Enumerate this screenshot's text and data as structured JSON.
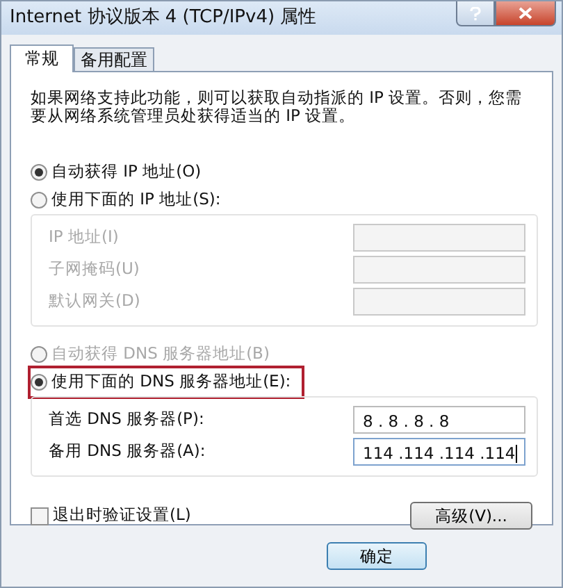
{
  "window": {
    "title": "Internet 协议版本 4 (TCP/IPv4) 属性"
  },
  "tabs": [
    {
      "label": "常规",
      "selected": true
    },
    {
      "label": "备用配置",
      "selected": false
    }
  ],
  "description": "如果网络支持此功能，则可以获取自动指派的 IP 设置。否则，您需要从网络系统管理员处获得适当的 IP 设置。",
  "ip_mode": [
    {
      "label": "自动获得 IP 地址(O)",
      "selected": true
    },
    {
      "label": "使用下面的 IP 地址(S):",
      "selected": false
    }
  ],
  "ip_fields": [
    {
      "label": "IP 地址(I)",
      "disabled": true
    },
    {
      "label": "子网掩码(U)",
      "disabled": true
    },
    {
      "label": "默认网关(D)",
      "disabled": true
    }
  ],
  "dns_mode": [
    {
      "label": "自动获得 DNS 服务器地址(B)",
      "selected": false,
      "disabled": true,
      "highlighted": false
    },
    {
      "label": "使用下面的 DNS 服务器地址(E):",
      "selected": true,
      "disabled": false,
      "highlighted": true
    }
  ],
  "dns_fields": [
    {
      "label": "首选 DNS 服务器(P):",
      "value": "8 . 8 . 8 . 8",
      "focused": false
    },
    {
      "label": "备用 DNS 服务器(A):",
      "value": "114 .114 .114 .114",
      "focused": true
    }
  ],
  "validate_checkbox": {
    "label": "退出时验证设置(L)",
    "checked": false
  },
  "advanced_button": "高级(V)...",
  "ok_button": "确定"
}
